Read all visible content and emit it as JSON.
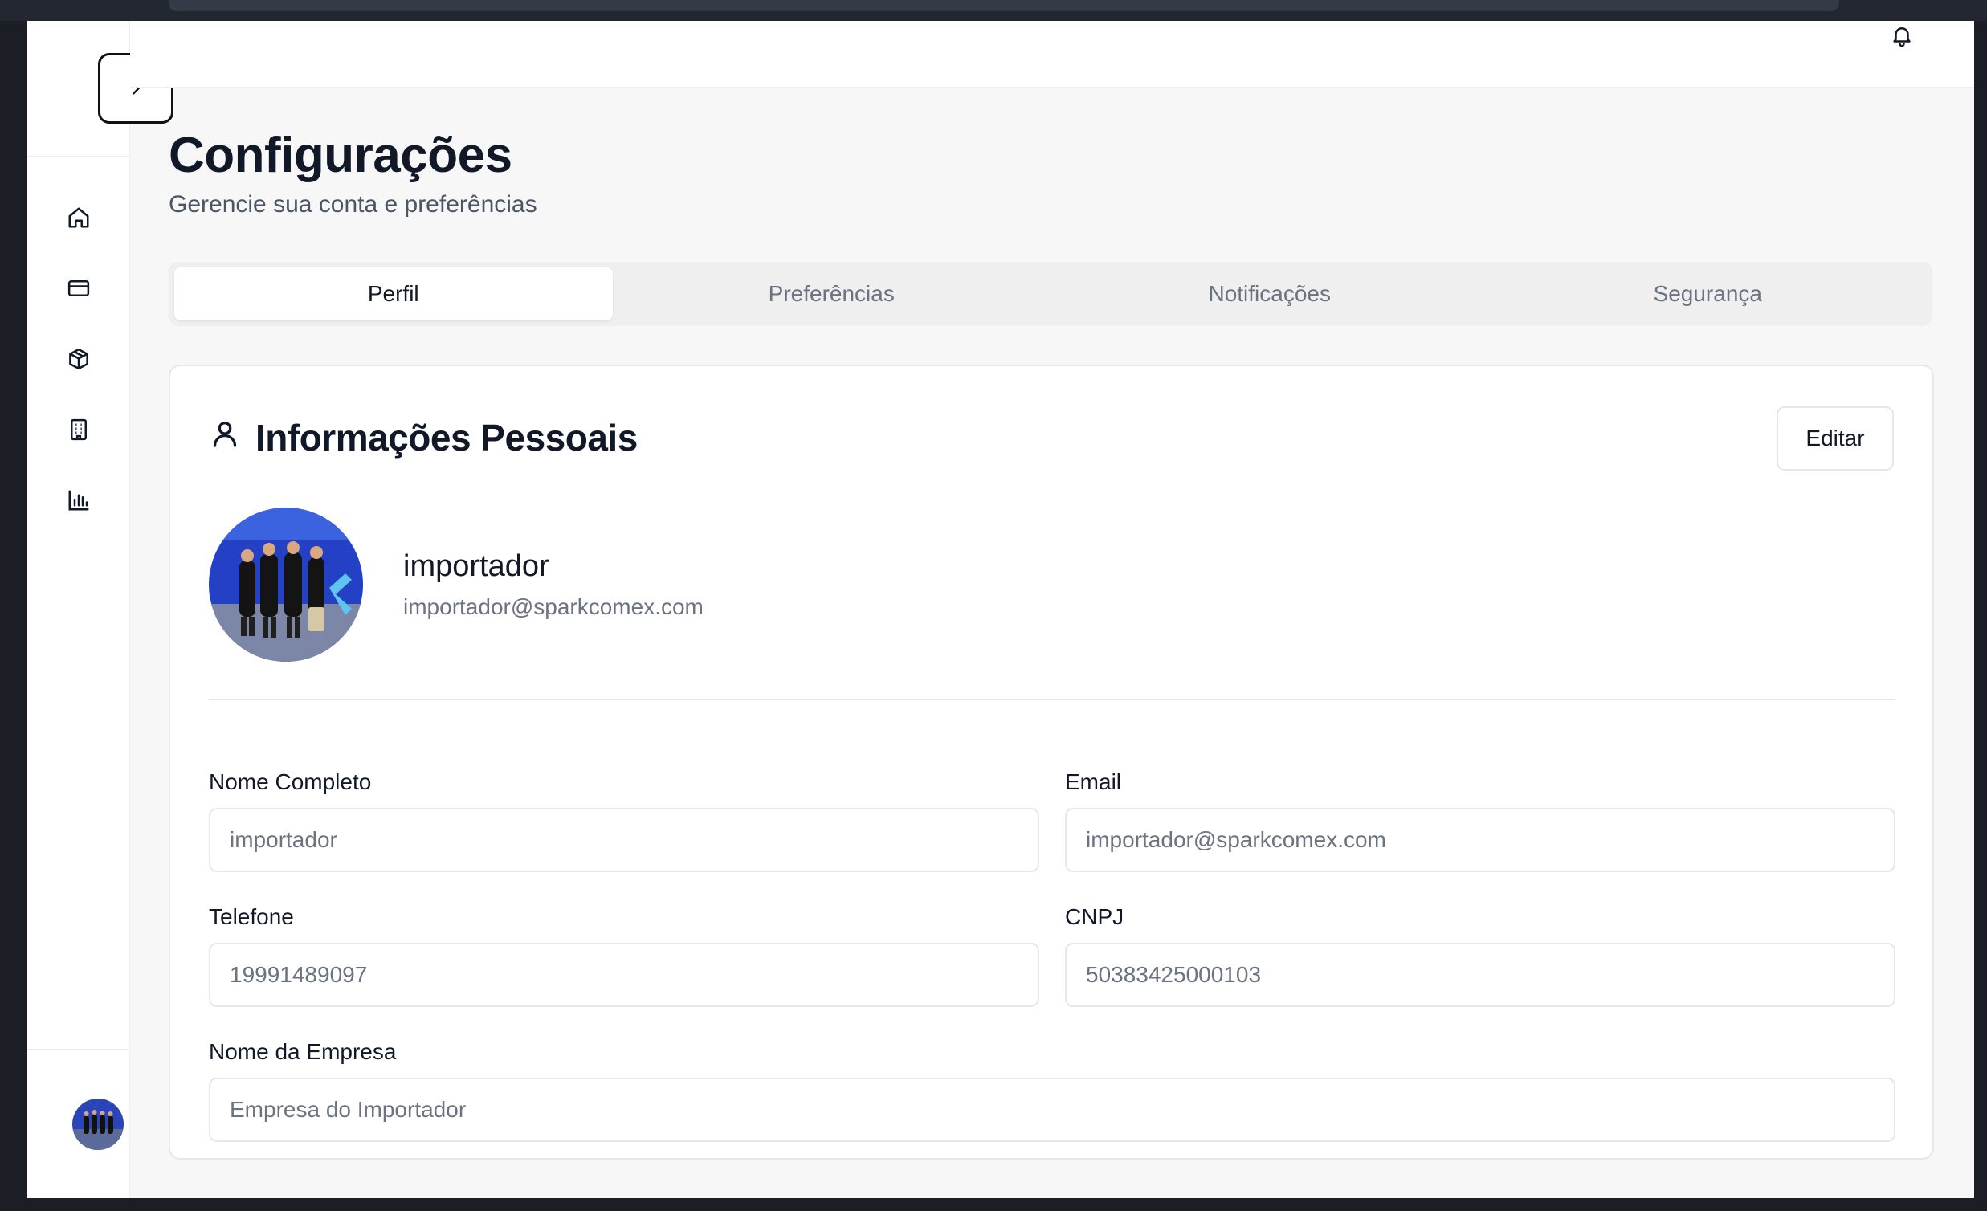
{
  "page": {
    "title": "Configurações",
    "subtitle": "Gerencie sua conta e preferências"
  },
  "sidebar": {
    "items": [
      {
        "icon": "home-icon"
      },
      {
        "icon": "credit-card-icon"
      },
      {
        "icon": "package-icon"
      },
      {
        "icon": "building-icon"
      },
      {
        "icon": "bar-chart-icon"
      }
    ]
  },
  "tabs": [
    {
      "label": "Perfil",
      "active": true
    },
    {
      "label": "Preferências",
      "active": false
    },
    {
      "label": "Notificações",
      "active": false
    },
    {
      "label": "Segurança",
      "active": false
    }
  ],
  "card": {
    "title": "Informações Pessoais",
    "edit_label": "Editar",
    "profile": {
      "name": "importador",
      "email": "importador@sparkcomex.com"
    },
    "fields": {
      "full_name": {
        "label": "Nome Completo",
        "value": "importador"
      },
      "email": {
        "label": "Email",
        "value": "importador@sparkcomex.com"
      },
      "phone": {
        "label": "Telefone",
        "value": "19991489097"
      },
      "cnpj": {
        "label": "CNPJ",
        "value": "50383425000103"
      },
      "company": {
        "label": "Nome da Empresa",
        "value": "Empresa do Importador"
      }
    }
  },
  "colors": {
    "accent": "#111827",
    "muted": "#6b7280",
    "border": "#e5e7eb"
  }
}
